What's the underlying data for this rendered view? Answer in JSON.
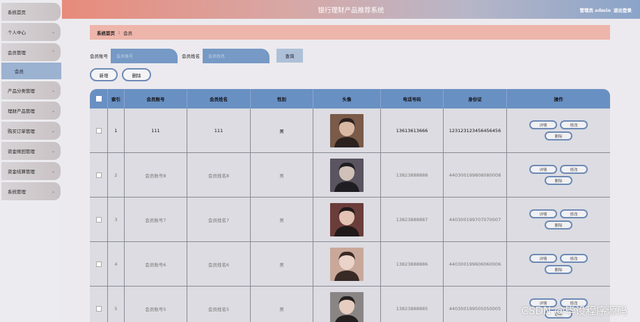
{
  "app": {
    "title": "银行理财产品推荐系统",
    "user_label": "管理员 admin",
    "logout_label": "退出登录"
  },
  "sidebar": {
    "items": [
      {
        "label": "系统首页",
        "has_chevron": false
      },
      {
        "label": "个人中心",
        "has_chevron": true
      },
      {
        "label": "会员管理",
        "has_chevron": true,
        "expanded": true
      },
      {
        "label": "产品分类管理",
        "has_chevron": true
      },
      {
        "label": "理财产品管理",
        "has_chevron": true
      },
      {
        "label": "购买订单管理",
        "has_chevron": true
      },
      {
        "label": "资金赎回管理",
        "has_chevron": true
      },
      {
        "label": "资金结算管理",
        "has_chevron": true
      },
      {
        "label": "系统管理",
        "has_chevron": true
      }
    ],
    "sub_item": "会员",
    "chevron_icon": "chevron-down-icon"
  },
  "breadcrumb": {
    "home": "系统首页",
    "separator": "⁝",
    "current": "会员"
  },
  "search": {
    "account_label": "会员账号",
    "account_placeholder": "会员账号",
    "name_label": "会员姓名",
    "name_placeholder": "会员姓名",
    "query_label": "查询"
  },
  "toolbar": {
    "add_label": "新增",
    "delete_label": "删除"
  },
  "table": {
    "headers": [
      "索引",
      "会员账号",
      "会员姓名",
      "性别",
      "头像",
      "电话号码",
      "身份证",
      "操作"
    ],
    "rows": [
      {
        "index": "1",
        "account": "111",
        "name": "111",
        "gender": "男",
        "phone": "13613613666",
        "id_card": "123123123456456456"
      },
      {
        "index": "2",
        "account": "会员账号8",
        "name": "会员姓名8",
        "gender": "男",
        "phone": "13823888888",
        "id_card": "440300199808080008"
      },
      {
        "index": "3",
        "account": "会员账号7",
        "name": "会员姓名7",
        "gender": "男",
        "phone": "13823888887",
        "id_card": "440300199707070007"
      },
      {
        "index": "4",
        "account": "会员账号6",
        "name": "会员姓名6",
        "gender": "男",
        "phone": "13823888886",
        "id_card": "440300199606060006"
      },
      {
        "index": "5",
        "account": "会员账号5",
        "name": "会员姓名5",
        "gender": "男",
        "phone": "13823888885",
        "id_card": "440300199505050005"
      }
    ],
    "row_actions": {
      "detail": "详情",
      "edit": "修改",
      "delete": "删除"
    }
  },
  "watermark": "CSDN @毕设程序源码",
  "colors": {
    "header_gradient_start": "#e88b7b",
    "header_gradient_end": "#8aa4c9",
    "table_header": "#6990c3",
    "button_border": "#6d8ab5",
    "breadcrumb_bg": "#eeb5ab"
  }
}
